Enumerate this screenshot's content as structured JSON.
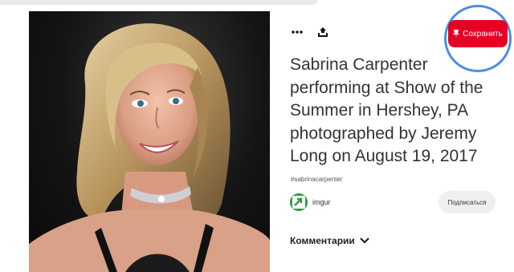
{
  "pin": {
    "title": "Sabrina Carpenter performing at Show of the Summer in Hershey, PA photographed by Jeremy Long on August 19, 2017",
    "hashtag": "#sabrinacarpenter"
  },
  "toolbar": {
    "more_icon": "more-dots-icon",
    "share_icon": "share-upload-icon",
    "save_label": "Сохранить",
    "save_icon": "pin-icon"
  },
  "creator": {
    "name": "imgur",
    "subscribe_label": "Подписаться"
  },
  "comments": {
    "label": "Комментарии",
    "icon": "chevron-down-icon"
  },
  "colors": {
    "save_red": "#e60023",
    "highlight_ring": "#4b8fe0"
  }
}
